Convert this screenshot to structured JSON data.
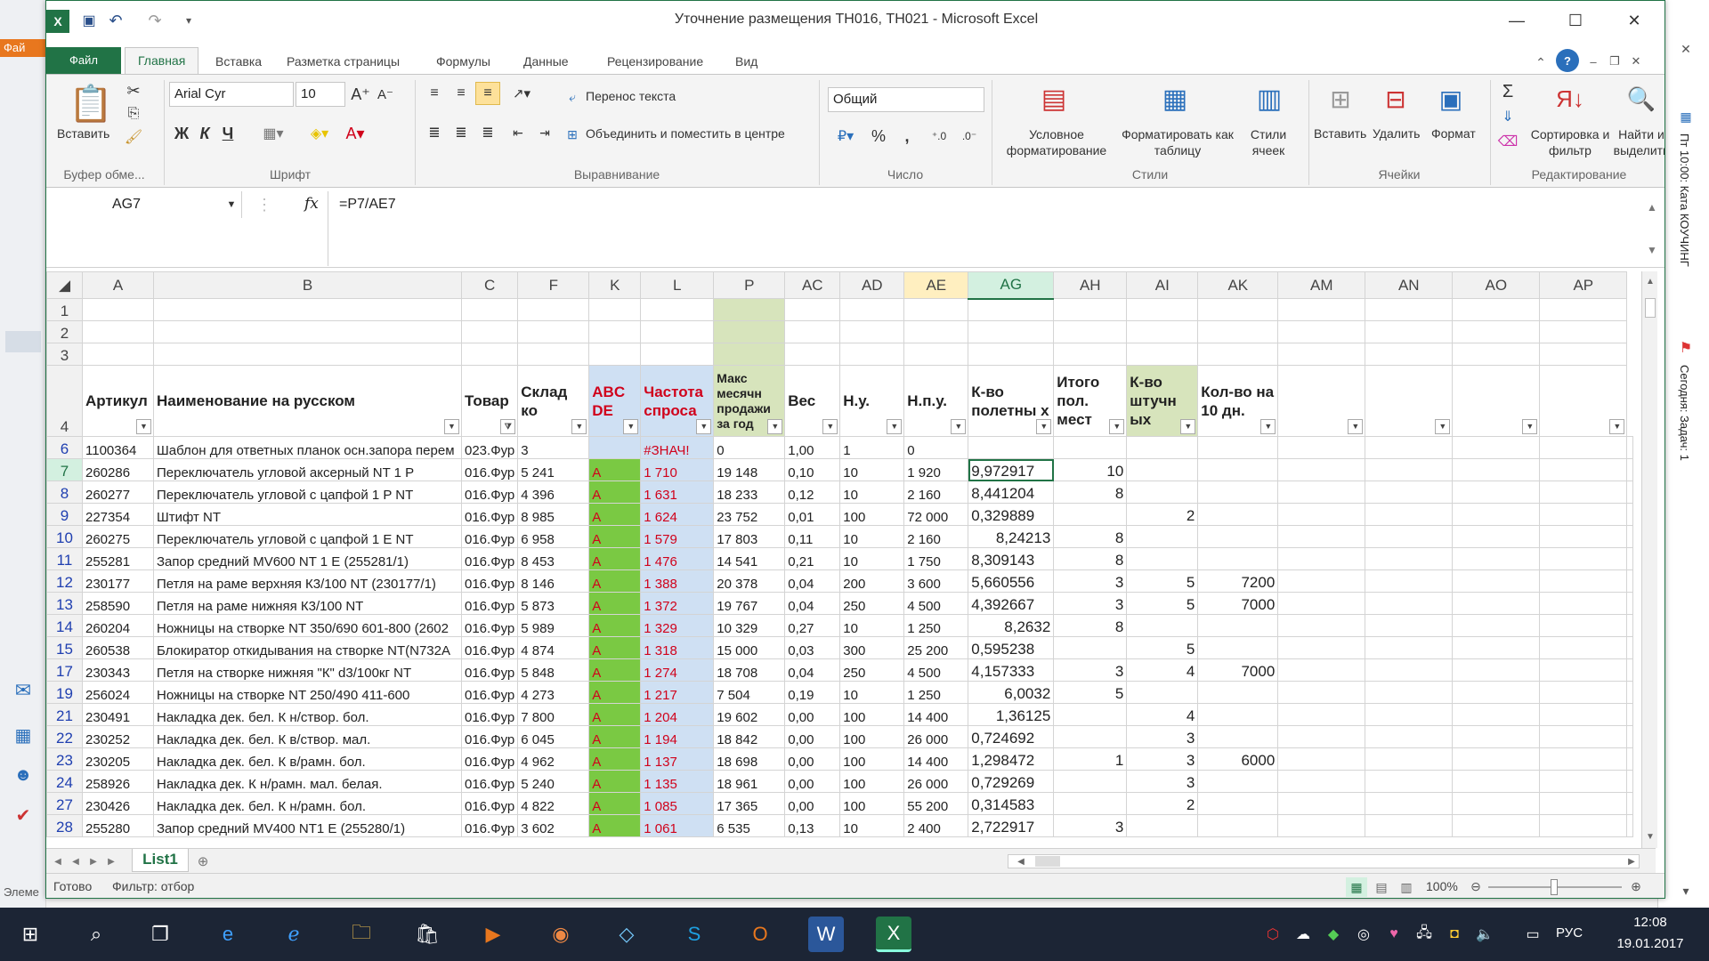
{
  "window": {
    "title": "Уточнение размещения ТН016, ТН021 - Microsoft Excel"
  },
  "tabs": [
    "Файл",
    "Главная",
    "Вставка",
    "Разметка страницы",
    "Формулы",
    "Данные",
    "Рецензирование",
    "Вид"
  ],
  "ribbon": {
    "clipboard": {
      "paste": "Вставить",
      "label": "Буфер обме..."
    },
    "font": {
      "name": "Arial Cyr",
      "size": "10",
      "label": "Шрифт",
      "bold": "Ж",
      "italic": "К",
      "underline": "Ч"
    },
    "alignment": {
      "wrap": "Перенос текста",
      "merge": "Объединить и поместить в центре",
      "label": "Выравнивание"
    },
    "number": {
      "format": "Общий",
      "label": "Число",
      "percent": "%",
      "comma": ","
    },
    "styles": {
      "conditional": "Условное форматирование",
      "table": "Форматировать как таблицу",
      "cell": "Стили ячеек",
      "label": "Стили"
    },
    "cells": {
      "insert": "Вставить",
      "delete": "Удалить",
      "format": "Формат",
      "label": "Ячейки"
    },
    "editing": {
      "sort": "Сортировка и фильтр",
      "find": "Найти и выделить",
      "label": "Редактирование"
    }
  },
  "formula_bar": {
    "name_box": "AG7",
    "fx": "fx",
    "formula": "=P7/AE7"
  },
  "columns": [
    "A",
    "B",
    "C",
    "F",
    "K",
    "L",
    "P",
    "AC",
    "AD",
    "AE",
    "AG",
    "AH",
    "AI",
    "AK",
    "AM",
    "AN",
    "AO",
    "AP"
  ],
  "header_row": {
    "row": "4",
    "A": "Артикул",
    "B": "Наименование на русском",
    "C": "Товар",
    "F": "Склад ко",
    "K": "ABC DE",
    "L": "Частота спроса",
    "P": "Макс месячн продажи за год",
    "AC": "Вес",
    "AD": "Н.у.",
    "AE": "Н.п.у.",
    "AG": "К-во полетны х",
    "AH": "Итого пол. мест",
    "AI": "К-во штучн ых",
    "AK": "Кол-во на 10 дн."
  },
  "empty_rows": [
    "1",
    "2",
    "3"
  ],
  "rows": [
    {
      "n": "6",
      "a": "1100364",
      "b": "Шаблон для ответных планок осн.запора перем",
      "c": "023.Фур",
      "f": "3",
      "k": "",
      "l": "#ЗНАЧ!",
      "p": "0",
      "ac": "1,00",
      "ad": "1",
      "ae": "0",
      "ag": "",
      "ah": "",
      "ai": "",
      "ak": ""
    },
    {
      "n": "7",
      "a": "260286",
      "b": "Переключатель  угловой аксерный  NT 1 P",
      "c": "016.Фур",
      "f": "5 241",
      "k": "A",
      "l": "1 710",
      "p": "19 148",
      "ac": "0,10",
      "ad": "10",
      "ae": "1 920",
      "ag": "9,972917",
      "ah": "10",
      "ai": "",
      "ak": ""
    },
    {
      "n": "8",
      "a": "260277",
      "b": "Переключатель угловой  с цапфой 1 P NT",
      "c": "016.Фур",
      "f": "4 396",
      "k": "A",
      "l": "1 631",
      "p": "18 233",
      "ac": "0,12",
      "ad": "10",
      "ae": "2 160",
      "ag": "8,441204",
      "ah": "8",
      "ai": "",
      "ak": ""
    },
    {
      "n": "9",
      "a": "227354",
      "b": "Штифт NT",
      "c": "016.Фур",
      "f": "8 985",
      "k": "A",
      "l": "1 624",
      "p": "23 752",
      "ac": "0,01",
      "ad": "100",
      "ae": "72 000",
      "ag": "0,329889",
      "ah": "",
      "ai": "2",
      "ak": ""
    },
    {
      "n": "10",
      "a": "260275",
      "b": "Переключатель угловой с цапфой 1 E NT",
      "c": "016.Фур",
      "f": "6 958",
      "k": "A",
      "l": "1 579",
      "p": "17 803",
      "ac": "0,11",
      "ad": "10",
      "ae": "2 160",
      "ag": "8,24213",
      "ah": "8",
      "ai": "",
      "ak": ""
    },
    {
      "n": "11",
      "a": "255281",
      "b": "Запор средний MV600 NT 1 E (255281/1)",
      "c": "016.Фур",
      "f": "8 453",
      "k": "A",
      "l": "1 476",
      "p": "14 541",
      "ac": "0,21",
      "ad": "10",
      "ae": "1 750",
      "ag": "8,309143",
      "ah": "8",
      "ai": "",
      "ak": ""
    },
    {
      "n": "12",
      "a": "230177",
      "b": "Петля на раме верхняя К3/100 NT (230177/1)",
      "c": "016.Фур",
      "f": "8 146",
      "k": "A",
      "l": "1 388",
      "p": "20 378",
      "ac": "0,04",
      "ad": "200",
      "ae": "3 600",
      "ag": "5,660556",
      "ah": "3",
      "ai": "5",
      "ak": "7200"
    },
    {
      "n": "13",
      "a": "258590",
      "b": "Петля на раме нижняя  К3/100 NT",
      "c": "016.Фур",
      "f": "5 873",
      "k": "A",
      "l": "1 372",
      "p": "19 767",
      "ac": "0,04",
      "ad": "250",
      "ae": "4 500",
      "ag": "4,392667",
      "ah": "3",
      "ai": "5",
      "ak": "7000"
    },
    {
      "n": "14",
      "a": "260204",
      "b": "Ножницы на створке NT 350/690 601-800 (2602",
      "c": "016.Фур",
      "f": "5 989",
      "k": "A",
      "l": "1 329",
      "p": "10 329",
      "ac": "0,27",
      "ad": "10",
      "ae": "1 250",
      "ag": "8,2632",
      "ah": "8",
      "ai": "",
      "ak": ""
    },
    {
      "n": "15",
      "a": "260538",
      "b": "Блокиратор откидывания на створке NT(N732A",
      "c": "016.Фур",
      "f": "4 874",
      "k": "A",
      "l": "1 318",
      "p": "15 000",
      "ac": "0,03",
      "ad": "300",
      "ae": "25 200",
      "ag": "0,595238",
      "ah": "",
      "ai": "5",
      "ak": ""
    },
    {
      "n": "17",
      "a": "230343",
      "b": "Петля на створке нижняя \"К\" d3/100кг NT",
      "c": "016.Фур",
      "f": "5 848",
      "k": "A",
      "l": "1 274",
      "p": "18 708",
      "ac": "0,04",
      "ad": "250",
      "ae": "4 500",
      "ag": "4,157333",
      "ah": "3",
      "ai": "4",
      "ak": "7000"
    },
    {
      "n": "19",
      "a": "256024",
      "b": "Ножницы на створке NT 250/490 411-600",
      "c": "016.Фур",
      "f": "4 273",
      "k": "A",
      "l": "1 217",
      "p": "7 504",
      "ac": "0,19",
      "ad": "10",
      "ae": "1 250",
      "ag": "6,0032",
      "ah": "5",
      "ai": "",
      "ak": ""
    },
    {
      "n": "21",
      "a": "230491",
      "b": "Накладка дек. бел. К н/створ. бол.",
      "c": "016.Фур",
      "f": "7 800",
      "k": "A",
      "l": "1 204",
      "p": "19 602",
      "ac": "0,00",
      "ad": "100",
      "ae": "14 400",
      "ag": "1,36125",
      "ah": "",
      "ai": "4",
      "ak": ""
    },
    {
      "n": "22",
      "a": "230252",
      "b": "Накладка дек. бел. К в/створ. мал.",
      "c": "016.Фур",
      "f": "6 045",
      "k": "A",
      "l": "1 194",
      "p": "18 842",
      "ac": "0,00",
      "ad": "100",
      "ae": "26 000",
      "ag": "0,724692",
      "ah": "",
      "ai": "3",
      "ak": ""
    },
    {
      "n": "23",
      "a": "230205",
      "b": "Накладка дек. бел. К в/рамн. бол.",
      "c": "016.Фур",
      "f": "4 962",
      "k": "A",
      "l": "1 137",
      "p": "18 698",
      "ac": "0,00",
      "ad": "100",
      "ae": "14 400",
      "ag": "1,298472",
      "ah": "1",
      "ai": "3",
      "ak": "6000"
    },
    {
      "n": "24",
      "a": "258926",
      "b": "Накладка дек. К н/рамн. мал. белая.",
      "c": "016.Фур",
      "f": "5 240",
      "k": "A",
      "l": "1 135",
      "p": "18 961",
      "ac": "0,00",
      "ad": "100",
      "ae": "26 000",
      "ag": "0,729269",
      "ah": "",
      "ai": "3",
      "ak": ""
    },
    {
      "n": "27",
      "a": "230426",
      "b": "Накладка дек. бел. К н/рамн. бол.",
      "c": "016.Фур",
      "f": "4 822",
      "k": "A",
      "l": "1 085",
      "p": "17 365",
      "ac": "0,00",
      "ad": "100",
      "ae": "55 200",
      "ag": "0,314583",
      "ah": "",
      "ai": "2",
      "ak": ""
    },
    {
      "n": "28",
      "a": "255280",
      "b": "Запор средний MV400 NT1 E (255280/1)",
      "c": "016.Фур",
      "f": "3 602",
      "k": "A",
      "l": "1 061",
      "p": "6 535",
      "ac": "0,13",
      "ad": "10",
      "ae": "2 400",
      "ag": "2,722917",
      "ah": "3",
      "ai": "",
      "ak": ""
    }
  ],
  "sheet_tab": "List1",
  "status": {
    "ready": "Готово",
    "filter": "Фильтр: отбор",
    "zoom": "100%"
  },
  "taskbar": {
    "lang": "РУС",
    "time": "12:08",
    "date": "19.01.2017"
  },
  "side_panel": {
    "line1": "Пт 10:00: Ката КОУЧИНГ",
    "line2": "Сегодня: Задач: 1"
  },
  "bg_window": {
    "file_tab": "Фай",
    "left_text": "Элеме"
  }
}
